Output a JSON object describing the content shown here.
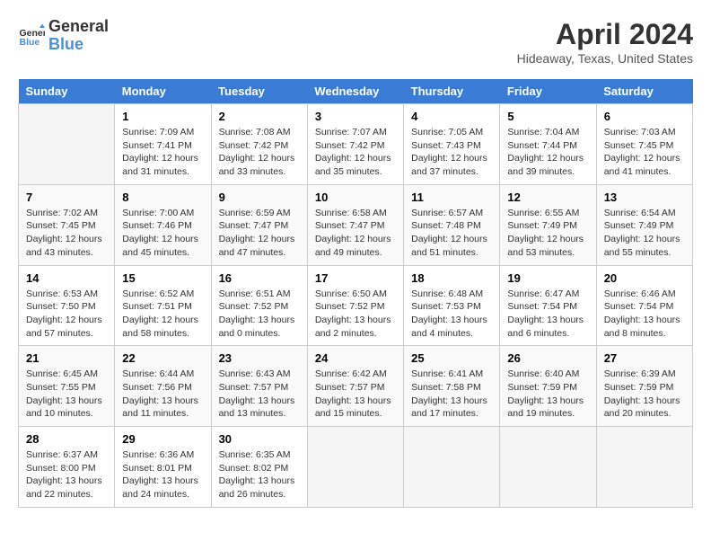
{
  "header": {
    "logo_line1": "General",
    "logo_line2": "Blue",
    "title": "April 2024",
    "subtitle": "Hideaway, Texas, United States"
  },
  "days_of_week": [
    "Sunday",
    "Monday",
    "Tuesday",
    "Wednesday",
    "Thursday",
    "Friday",
    "Saturday"
  ],
  "weeks": [
    [
      {
        "num": "",
        "detail": ""
      },
      {
        "num": "1",
        "detail": "Sunrise: 7:09 AM\nSunset: 7:41 PM\nDaylight: 12 hours\nand 31 minutes."
      },
      {
        "num": "2",
        "detail": "Sunrise: 7:08 AM\nSunset: 7:42 PM\nDaylight: 12 hours\nand 33 minutes."
      },
      {
        "num": "3",
        "detail": "Sunrise: 7:07 AM\nSunset: 7:42 PM\nDaylight: 12 hours\nand 35 minutes."
      },
      {
        "num": "4",
        "detail": "Sunrise: 7:05 AM\nSunset: 7:43 PM\nDaylight: 12 hours\nand 37 minutes."
      },
      {
        "num": "5",
        "detail": "Sunrise: 7:04 AM\nSunset: 7:44 PM\nDaylight: 12 hours\nand 39 minutes."
      },
      {
        "num": "6",
        "detail": "Sunrise: 7:03 AM\nSunset: 7:45 PM\nDaylight: 12 hours\nand 41 minutes."
      }
    ],
    [
      {
        "num": "7",
        "detail": "Sunrise: 7:02 AM\nSunset: 7:45 PM\nDaylight: 12 hours\nand 43 minutes."
      },
      {
        "num": "8",
        "detail": "Sunrise: 7:00 AM\nSunset: 7:46 PM\nDaylight: 12 hours\nand 45 minutes."
      },
      {
        "num": "9",
        "detail": "Sunrise: 6:59 AM\nSunset: 7:47 PM\nDaylight: 12 hours\nand 47 minutes."
      },
      {
        "num": "10",
        "detail": "Sunrise: 6:58 AM\nSunset: 7:47 PM\nDaylight: 12 hours\nand 49 minutes."
      },
      {
        "num": "11",
        "detail": "Sunrise: 6:57 AM\nSunset: 7:48 PM\nDaylight: 12 hours\nand 51 minutes."
      },
      {
        "num": "12",
        "detail": "Sunrise: 6:55 AM\nSunset: 7:49 PM\nDaylight: 12 hours\nand 53 minutes."
      },
      {
        "num": "13",
        "detail": "Sunrise: 6:54 AM\nSunset: 7:49 PM\nDaylight: 12 hours\nand 55 minutes."
      }
    ],
    [
      {
        "num": "14",
        "detail": "Sunrise: 6:53 AM\nSunset: 7:50 PM\nDaylight: 12 hours\nand 57 minutes."
      },
      {
        "num": "15",
        "detail": "Sunrise: 6:52 AM\nSunset: 7:51 PM\nDaylight: 12 hours\nand 58 minutes."
      },
      {
        "num": "16",
        "detail": "Sunrise: 6:51 AM\nSunset: 7:52 PM\nDaylight: 13 hours\nand 0 minutes."
      },
      {
        "num": "17",
        "detail": "Sunrise: 6:50 AM\nSunset: 7:52 PM\nDaylight: 13 hours\nand 2 minutes."
      },
      {
        "num": "18",
        "detail": "Sunrise: 6:48 AM\nSunset: 7:53 PM\nDaylight: 13 hours\nand 4 minutes."
      },
      {
        "num": "19",
        "detail": "Sunrise: 6:47 AM\nSunset: 7:54 PM\nDaylight: 13 hours\nand 6 minutes."
      },
      {
        "num": "20",
        "detail": "Sunrise: 6:46 AM\nSunset: 7:54 PM\nDaylight: 13 hours\nand 8 minutes."
      }
    ],
    [
      {
        "num": "21",
        "detail": "Sunrise: 6:45 AM\nSunset: 7:55 PM\nDaylight: 13 hours\nand 10 minutes."
      },
      {
        "num": "22",
        "detail": "Sunrise: 6:44 AM\nSunset: 7:56 PM\nDaylight: 13 hours\nand 11 minutes."
      },
      {
        "num": "23",
        "detail": "Sunrise: 6:43 AM\nSunset: 7:57 PM\nDaylight: 13 hours\nand 13 minutes."
      },
      {
        "num": "24",
        "detail": "Sunrise: 6:42 AM\nSunset: 7:57 PM\nDaylight: 13 hours\nand 15 minutes."
      },
      {
        "num": "25",
        "detail": "Sunrise: 6:41 AM\nSunset: 7:58 PM\nDaylight: 13 hours\nand 17 minutes."
      },
      {
        "num": "26",
        "detail": "Sunrise: 6:40 AM\nSunset: 7:59 PM\nDaylight: 13 hours\nand 19 minutes."
      },
      {
        "num": "27",
        "detail": "Sunrise: 6:39 AM\nSunset: 7:59 PM\nDaylight: 13 hours\nand 20 minutes."
      }
    ],
    [
      {
        "num": "28",
        "detail": "Sunrise: 6:37 AM\nSunset: 8:00 PM\nDaylight: 13 hours\nand 22 minutes."
      },
      {
        "num": "29",
        "detail": "Sunrise: 6:36 AM\nSunset: 8:01 PM\nDaylight: 13 hours\nand 24 minutes."
      },
      {
        "num": "30",
        "detail": "Sunrise: 6:35 AM\nSunset: 8:02 PM\nDaylight: 13 hours\nand 26 minutes."
      },
      {
        "num": "",
        "detail": ""
      },
      {
        "num": "",
        "detail": ""
      },
      {
        "num": "",
        "detail": ""
      },
      {
        "num": "",
        "detail": ""
      }
    ]
  ]
}
